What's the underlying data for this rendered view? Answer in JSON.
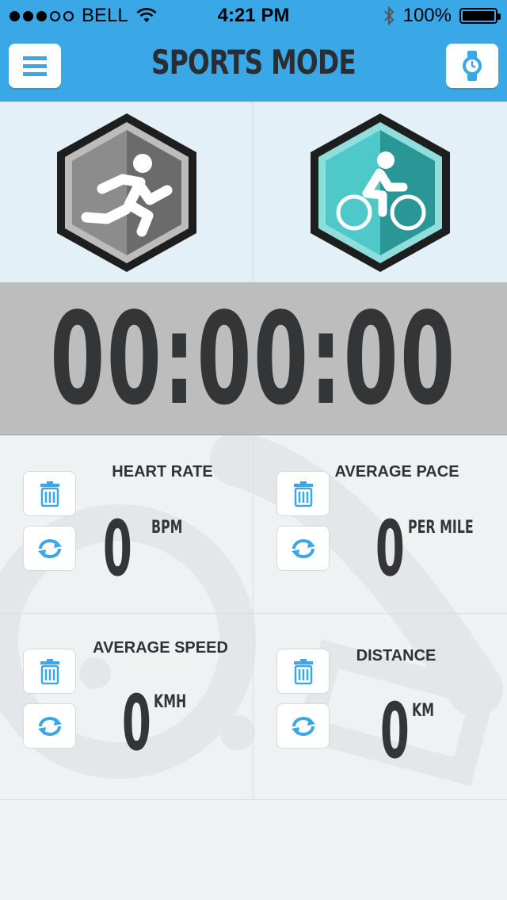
{
  "status_bar": {
    "carrier": "BELL",
    "time": "4:21 PM",
    "battery": "100%"
  },
  "header": {
    "title": "SPORTS MODE",
    "menu_icon": "hamburger-menu-icon",
    "watch_icon": "watch-icon"
  },
  "modes": [
    {
      "name": "running",
      "icon": "running-icon",
      "color_left": "#8c8c8c",
      "color_right": "#6b6b6b",
      "active": false
    },
    {
      "name": "cycling",
      "icon": "cycling-icon",
      "color_left": "#4ec8c8",
      "color_right": "#2a9696",
      "active": true
    }
  ],
  "timer": {
    "value": "00:00:00"
  },
  "stats": [
    {
      "label": "HEART RATE",
      "value": "0",
      "unit": "BPM"
    },
    {
      "label": "AVERAGE PACE",
      "value": "0",
      "unit": "PER MILE"
    },
    {
      "label": "AVERAGE SPEED",
      "value": "0",
      "unit": "KMH"
    },
    {
      "label": "DISTANCE",
      "value": "0",
      "unit": "KM"
    }
  ],
  "colors": {
    "accent": "#3aa8e7",
    "header_bg": "#3aa8e7",
    "timer_bg": "#bdbdbd",
    "text_dark": "#333537"
  }
}
